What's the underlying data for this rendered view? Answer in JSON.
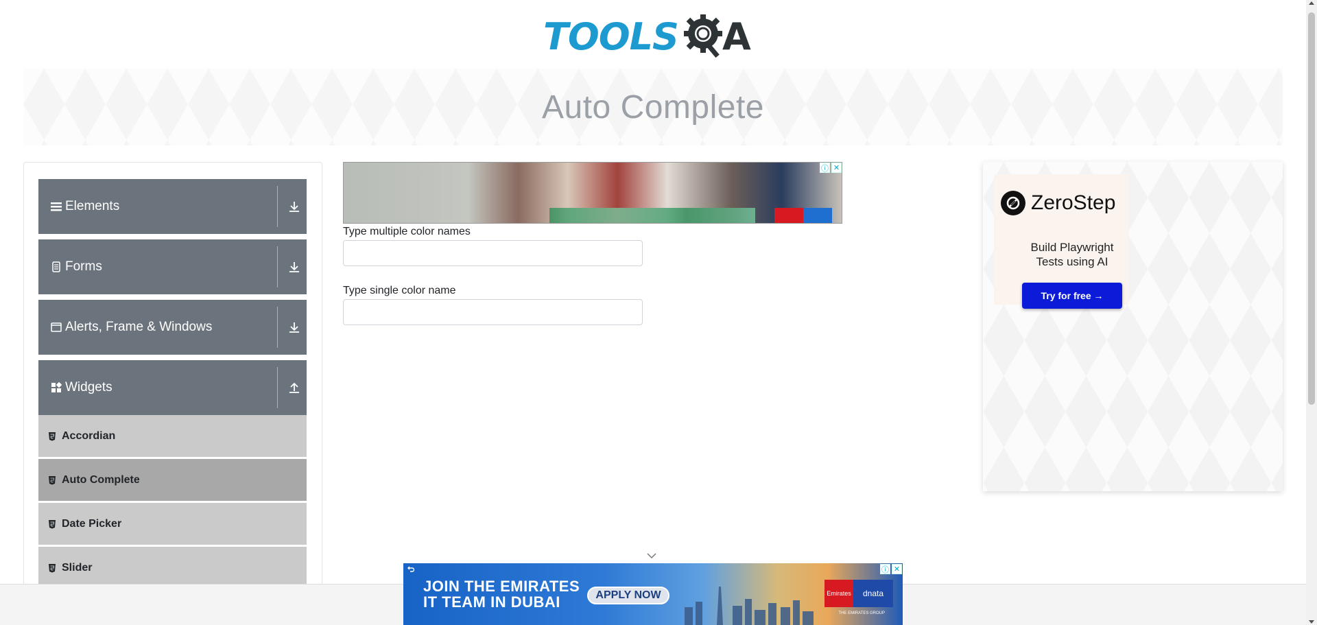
{
  "header": {
    "logo_text": "TOOLS",
    "logo_tail": "A"
  },
  "banner": {
    "title": "Auto Complete"
  },
  "sidebar": {
    "groups": [
      {
        "label": "Elements",
        "icon": "hamburger-icon"
      },
      {
        "label": "Forms",
        "icon": "document-icon"
      },
      {
        "label": "Alerts, Frame & Windows",
        "icon": "window-icon"
      },
      {
        "label": "Widgets",
        "icon": "widgets-icon"
      }
    ],
    "widgets_items": [
      {
        "label": "Accordian"
      },
      {
        "label": "Auto Complete",
        "active": true
      },
      {
        "label": "Date Picker"
      },
      {
        "label": "Slider"
      }
    ]
  },
  "form": {
    "multiple_label": "Type multiple color names",
    "multiple_value": "",
    "single_label": "Type single color name",
    "single_value": ""
  },
  "ads": {
    "right": {
      "brand": "ZeroStep",
      "tagline_1": "Build Playwright",
      "tagline_2": "Tests using AI",
      "cta": "Try for free →"
    },
    "bottom": {
      "headline_1": "JOIN THE EMIRATES",
      "headline_2": "IT TEAM IN DUBAI",
      "cta": "APPLY NOW",
      "brand_1": "Emirates",
      "brand_2": "dnata",
      "group_tag": "THE EMIRATES GROUP"
    },
    "chip_info": "ⓘ",
    "chip_close": "✕"
  },
  "colors": {
    "accent": "#1d9bd1",
    "sidebar_group": "#6b737c",
    "submenu": "#cacaca",
    "submenu_active": "#a8a8a8",
    "cta_blue": "#0b1bd8"
  }
}
